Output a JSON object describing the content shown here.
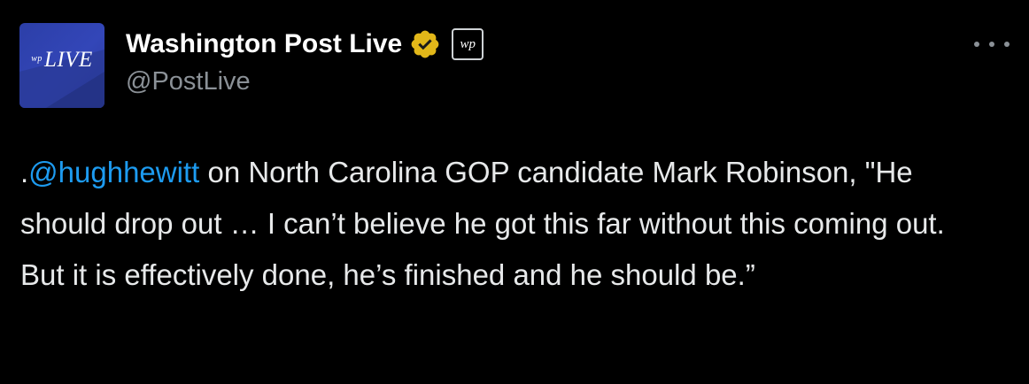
{
  "account": {
    "avatar_prefix": "wp",
    "avatar_text": "LIVE",
    "display_name": "Washington Post Live",
    "handle": "@PostLive",
    "verified_icon": "gold-verified-badge-icon",
    "affiliate_badge_text": "wp"
  },
  "menu": {
    "icon": "more-horizontal-icon"
  },
  "tweet": {
    "prefix": ".",
    "mention": "@hughhewitt",
    "body": " on North Carolina GOP candidate Mark Robinson, \"He should drop out … I can’t believe he got this far without this coming out. But it is effectively done, he’s finished and he should be.”"
  },
  "colors": {
    "background": "#000000",
    "text": "#e7e9ea",
    "secondary_text": "#8b9197",
    "mention": "#1d9bf0",
    "verified_gold": "#e2b719",
    "avatar_blue": "#3346b8"
  }
}
